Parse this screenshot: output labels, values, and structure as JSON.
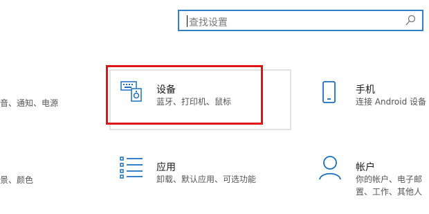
{
  "search": {
    "placeholder": "查找设置"
  },
  "left_partials": {
    "row1": "音、通知、电源",
    "row2": "景、颜色"
  },
  "tiles": [
    {
      "title": "设备",
      "desc": "蓝牙、打印机、鼠标",
      "icon": "devices-icon"
    },
    {
      "title": "手机",
      "desc": "连接 Android 设备",
      "icon": "phone-icon"
    },
    {
      "title": "应用",
      "desc": "卸载、默认应用、可选功能",
      "icon": "apps-icon"
    },
    {
      "title": "帐户",
      "desc_line1": "你的帐户、电子邮",
      "desc_line2": "置、工作、其他人",
      "icon": "account-icon"
    }
  ],
  "accent_colors": {
    "search_border": "#2d7fc6",
    "highlight": "#e01414",
    "icon_blue": "#1a6fc2"
  }
}
